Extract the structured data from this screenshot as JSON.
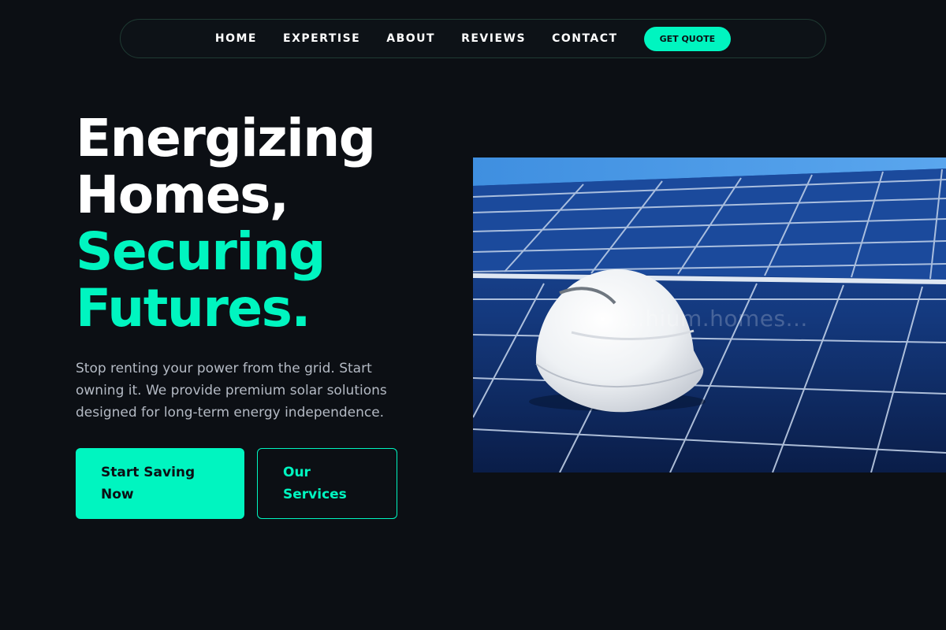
{
  "nav": {
    "links": [
      "HOME",
      "EXPERTISE",
      "ABOUT",
      "REVIEWS",
      "CONTACT"
    ],
    "cta": "GET QUOTE"
  },
  "hero": {
    "title_line1": "Energizing",
    "title_line2": "Homes,",
    "title_line3": "Securing",
    "title_line4": "Futures.",
    "description": "Stop renting your power from the grid. Start owning it. We provide premium solar solutions designed for long-term energy independence.",
    "primary_button": "Start Saving Now",
    "secondary_button": "Our Services",
    "image_watermark": "...hium.homes..."
  },
  "colors": {
    "background": "#0c0f14",
    "accent": "#00f5c0",
    "muted_text": "#b4bac4"
  },
  "icons": {
    "hero_image": "hard-hat-on-solar-panels"
  }
}
